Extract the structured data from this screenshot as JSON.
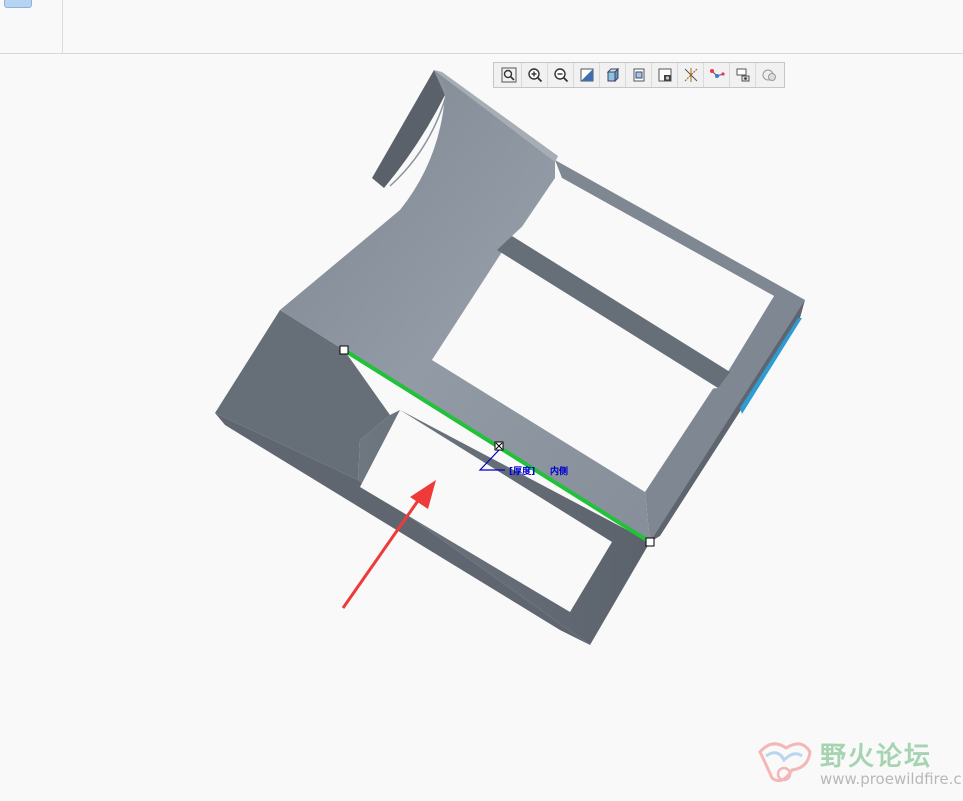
{
  "toolbar": {
    "buttons": [
      {
        "name": "zoom-fit-icon"
      },
      {
        "name": "zoom-in-icon"
      },
      {
        "name": "zoom-out-icon"
      },
      {
        "name": "repaint-icon"
      },
      {
        "name": "display-style-icon"
      },
      {
        "name": "saved-views-icon"
      },
      {
        "name": "view-manager-icon"
      },
      {
        "name": "datum-display-icon"
      },
      {
        "name": "spin-center-icon"
      },
      {
        "name": "annotation-display-icon"
      },
      {
        "name": "appearance-icon"
      }
    ]
  },
  "annotation": {
    "thickness_label": "[厚度]",
    "side_label": "内侧"
  },
  "watermark": {
    "title": "野火论坛",
    "url": "www.proewildfire.cn"
  },
  "colors": {
    "part_top": "#8a939d",
    "part_side": "#636b75",
    "part_dark": "#565d66",
    "selected_edge": "#22c13a",
    "arrow": "#ef3a3a",
    "annotation": "#0000cc",
    "watermark": "#98cda6"
  }
}
